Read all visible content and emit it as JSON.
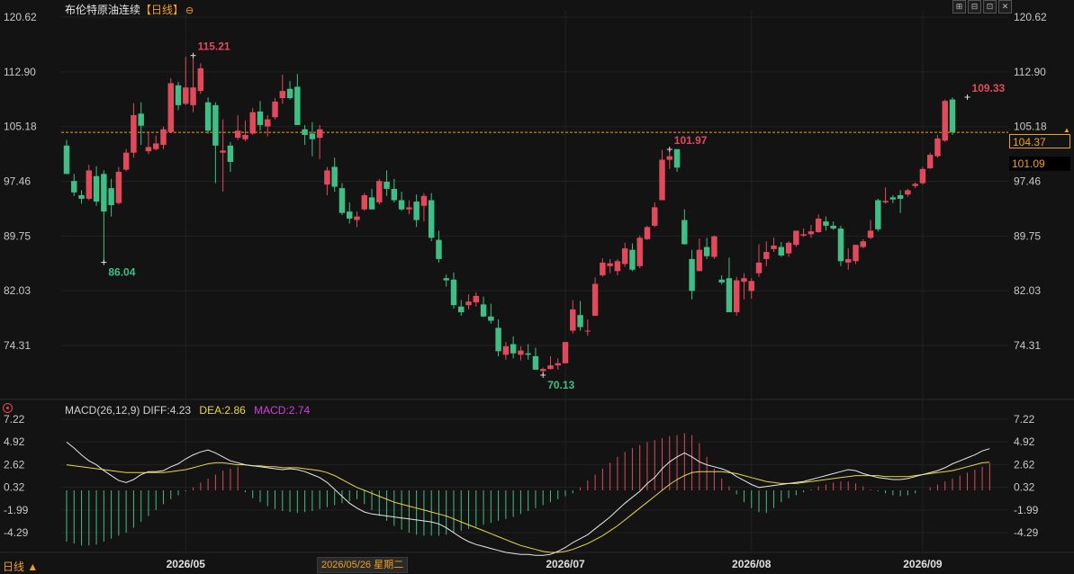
{
  "header": {
    "instrument": "布伦特原油连续",
    "period": "【日线】",
    "icon": "zoom-icon"
  },
  "toolbar": {
    "buttons": [
      "⊞",
      "⊟",
      "⊡",
      "✕"
    ]
  },
  "indicator": {
    "label": "MACD(26,12,9)",
    "diff": "DIFF:4.23",
    "dea": "DEA:2.86",
    "macd": "MACD:2.74"
  },
  "footer": {
    "period_button": "日线 ▲",
    "crosshair_date": "2026/05/26 星期二"
  },
  "price_tags": {
    "current": "104.37",
    "other": "101.09"
  },
  "colors": {
    "up": "#e24a5b",
    "down": "#3fbf86",
    "diff": "#e8e8e8",
    "dea": "#e8d840",
    "accent": "#f0a020"
  },
  "chart_data": [
    {
      "type": "candlestick",
      "title": "布伦特原油连续",
      "y_ticks": [
        "120.62",
        "112.90",
        "105.18",
        "97.46",
        "89.75",
        "82.03",
        "74.31"
      ],
      "ylim": [
        70.13,
        120.62
      ],
      "x_ticks": [
        {
          "label": "2026/05",
          "index": 16
        },
        {
          "label": "2026/07",
          "index": 67
        },
        {
          "label": "2026/08",
          "index": 92
        },
        {
          "label": "2026/09",
          "index": 115
        }
      ],
      "reference_line": 104.37,
      "annotations": [
        {
          "text": "115.21",
          "value": 115.21,
          "index": 17,
          "type": "high"
        },
        {
          "text": "86.04",
          "value": 86.04,
          "index": 5,
          "type": "low"
        },
        {
          "text": "70.13",
          "value": 70.13,
          "index": 64,
          "type": "low"
        },
        {
          "text": "101.97",
          "value": 101.97,
          "index": 81,
          "type": "high"
        },
        {
          "text": "109.33",
          "value": 109.33,
          "index": 121,
          "type": "high"
        }
      ],
      "ohlc": [
        [
          102.5,
          103.3,
          98.5,
          98.5
        ],
        [
          97.5,
          98.5,
          95.4,
          95.9
        ],
        [
          95.5,
          96.2,
          94.3,
          95.0
        ],
        [
          95.0,
          99.8,
          94.8,
          99.0
        ],
        [
          98.2,
          99.6,
          94.0,
          94.6
        ],
        [
          98.5,
          99.0,
          86.0,
          93.2
        ],
        [
          96.5,
          97.8,
          92.5,
          94.1
        ],
        [
          94.4,
          99.5,
          94.2,
          98.8
        ],
        [
          99.1,
          102.0,
          98.9,
          101.5
        ],
        [
          101.5,
          108.5,
          100.8,
          106.8
        ],
        [
          107.0,
          108.6,
          102.6,
          105.3
        ],
        [
          101.7,
          104.5,
          101.3,
          102.3
        ],
        [
          102.0,
          103.9,
          101.8,
          102.8
        ],
        [
          102.6,
          105.2,
          102.0,
          104.8
        ],
        [
          104.4,
          112.0,
          104.4,
          111.3
        ],
        [
          111.0,
          111.5,
          107.5,
          108.2
        ],
        [
          108.4,
          115.0,
          108.2,
          110.7
        ],
        [
          108.2,
          115.2,
          107.2,
          110.7
        ],
        [
          110.2,
          114.1,
          109.8,
          113.4
        ],
        [
          108.6,
          109.3,
          104.2,
          104.6
        ],
        [
          108.2,
          108.6,
          97.2,
          102.5
        ],
        [
          101.5,
          106.2,
          96.0,
          101.8
        ],
        [
          102.5,
          103.0,
          98.8,
          100.2
        ],
        [
          103.6,
          106.8,
          103.3,
          104.6
        ],
        [
          103.4,
          106.0,
          103.1,
          104.0
        ],
        [
          104.2,
          107.8,
          104.0,
          107.2
        ],
        [
          107.3,
          108.8,
          104.6,
          105.4
        ],
        [
          105.2,
          106.8,
          103.8,
          106.2
        ],
        [
          106.5,
          109.2,
          106.2,
          108.7
        ],
        [
          109.2,
          112.5,
          108.4,
          110.2
        ],
        [
          110.5,
          111.6,
          109.0,
          109.2
        ],
        [
          110.8,
          112.6,
          105.6,
          105.4
        ],
        [
          104.8,
          105.4,
          102.6,
          104.0
        ],
        [
          104.2,
          105.8,
          101.0,
          103.4
        ],
        [
          103.6,
          105.4,
          100.6,
          104.8
        ],
        [
          97.0,
          99.5,
          95.5,
          99.0
        ],
        [
          99.5,
          100.8,
          96.0,
          96.7
        ],
        [
          96.5,
          97.2,
          92.7,
          93.0
        ],
        [
          93.2,
          94.5,
          91.5,
          92.2
        ],
        [
          92.0,
          93.2,
          91.0,
          92.5
        ],
        [
          93.5,
          95.8,
          93.3,
          95.5
        ],
        [
          95.2,
          96.4,
          93.5,
          93.5
        ],
        [
          94.5,
          97.8,
          94.2,
          97.5
        ],
        [
          97.4,
          99.0,
          95.4,
          96.4
        ],
        [
          96.4,
          97.8,
          94.5,
          94.8
        ],
        [
          94.8,
          96.0,
          93.3,
          93.5
        ],
        [
          93.5,
          94.8,
          92.8,
          93.8
        ],
        [
          94.6,
          95.6,
          91.0,
          92.0
        ],
        [
          94.0,
          95.8,
          91.8,
          95.4
        ],
        [
          94.8,
          95.8,
          89.0,
          89.5
        ],
        [
          89.2,
          90.5,
          86.0,
          86.5
        ],
        [
          83.8,
          84.3,
          82.6,
          83.5
        ],
        [
          83.6,
          84.6,
          79.5,
          80.0
        ],
        [
          79.8,
          80.7,
          78.5,
          79.0
        ],
        [
          80.0,
          81.5,
          79.4,
          80.5
        ],
        [
          80.4,
          81.8,
          79.8,
          81.3
        ],
        [
          80.1,
          81.2,
          78.3,
          78.4
        ],
        [
          78.4,
          80.2,
          77.4,
          77.8
        ],
        [
          76.8,
          78.0,
          72.8,
          73.5
        ],
        [
          73.0,
          74.8,
          72.3,
          74.2
        ],
        [
          74.5,
          75.6,
          72.5,
          73.2
        ],
        [
          73.0,
          74.2,
          72.2,
          73.6
        ],
        [
          73.2,
          74.5,
          72.3,
          73.0
        ],
        [
          72.8,
          74.0,
          70.9,
          70.9
        ],
        [
          70.7,
          71.2,
          70.1,
          71.0
        ],
        [
          71.0,
          72.8,
          70.9,
          71.5
        ],
        [
          71.5,
          72.5,
          70.9,
          71.8
        ],
        [
          71.8,
          74.5,
          71.8,
          74.8
        ],
        [
          76.4,
          80.7,
          76.0,
          79.4
        ],
        [
          78.6,
          80.6,
          76.4,
          76.9
        ],
        [
          76.4,
          78.0,
          75.7,
          76.4
        ],
        [
          78.5,
          83.9,
          78.5,
          83.0
        ],
        [
          84.2,
          86.6,
          84.0,
          86.0
        ],
        [
          85.5,
          86.5,
          84.5,
          85.9
        ],
        [
          84.8,
          86.5,
          84.2,
          86.2
        ],
        [
          85.8,
          88.8,
          85.4,
          88.0
        ],
        [
          87.8,
          88.7,
          84.8,
          85.0
        ],
        [
          85.5,
          89.8,
          85.2,
          89.5
        ],
        [
          89.3,
          91.2,
          89.2,
          91.0
        ],
        [
          91.2,
          94.5,
          91.0,
          93.8
        ],
        [
          94.8,
          101.9,
          94.8,
          100.5
        ],
        [
          100.5,
          102.0,
          99.2,
          101.0
        ],
        [
          102.0,
          100.8,
          98.8,
          99.4
        ],
        [
          92.0,
          93.5,
          88.5,
          88.6
        ],
        [
          86.5,
          87.8,
          80.8,
          82.0
        ],
        [
          84.8,
          89.4,
          84.8,
          87.8
        ],
        [
          88.2,
          89.5,
          86.5,
          86.9
        ],
        [
          86.8,
          89.8,
          86.5,
          89.7
        ],
        [
          83.6,
          84.2,
          82.9,
          83.2
        ],
        [
          83.8,
          86.7,
          79.2,
          79.0
        ],
        [
          79.0,
          84.0,
          78.5,
          83.5
        ],
        [
          83.3,
          84.5,
          80.8,
          83.8
        ],
        [
          82.0,
          83.8,
          80.9,
          83.4
        ],
        [
          84.5,
          88.6,
          84.0,
          86.0
        ],
        [
          86.5,
          89.0,
          85.5,
          87.5
        ],
        [
          87.9,
          89.5,
          87.5,
          88.4
        ],
        [
          88.2,
          88.9,
          86.8,
          87.0
        ],
        [
          87.3,
          89.0,
          86.8,
          88.8
        ],
        [
          88.5,
          90.5,
          88.2,
          90.5
        ],
        [
          89.8,
          90.8,
          89.6,
          90.0
        ],
        [
          90.0,
          91.3,
          89.5,
          90.4
        ],
        [
          90.3,
          92.8,
          90.2,
          92.2
        ],
        [
          91.8,
          92.5,
          90.5,
          91.2
        ],
        [
          91.2,
          91.8,
          90.6,
          90.8
        ],
        [
          90.8,
          91.2,
          85.5,
          86.2
        ],
        [
          86.0,
          88.0,
          85.0,
          86.5
        ],
        [
          86.2,
          88.5,
          85.8,
          88.5
        ],
        [
          88.2,
          89.3,
          88.0,
          89.0
        ],
        [
          89.5,
          92.0,
          89.3,
          90.5
        ],
        [
          94.8,
          95.0,
          90.4,
          90.7
        ],
        [
          94.5,
          96.6,
          94.3,
          94.7
        ],
        [
          95.2,
          95.5,
          94.4,
          94.9
        ],
        [
          95.5,
          96.2,
          93.0,
          95.0
        ],
        [
          95.6,
          96.4,
          95.3,
          96.2
        ],
        [
          96.8,
          97.3,
          96.5,
          97.1
        ],
        [
          97.2,
          99.5,
          97.0,
          99.2
        ],
        [
          99.3,
          101.5,
          99.2,
          101.2
        ],
        [
          101.0,
          104.0,
          100.8,
          103.5
        ],
        [
          103.2,
          109.0,
          103.0,
          108.8
        ],
        [
          109.0,
          109.3,
          104.0,
          104.4
        ]
      ]
    },
    {
      "type": "macd",
      "title": "MACD(26,12,9)",
      "y_ticks": [
        "7.22",
        "4.92",
        "2.62",
        "0.32",
        "-1.99",
        "-4.29"
      ],
      "ylim": [
        -6.59,
        7.22
      ],
      "series": [
        {
          "name": "DIFF",
          "values": [
            4.9,
            4.3,
            3.6,
            3.0,
            2.6,
            2.0,
            1.5,
            1.0,
            0.8,
            1.1,
            1.6,
            1.9,
            1.9,
            2.0,
            2.4,
            2.7,
            3.2,
            3.6,
            3.9,
            4.1,
            3.8,
            3.4,
            3.0,
            2.8,
            2.6,
            2.5,
            2.4,
            2.3,
            2.2,
            2.1,
            2.2,
            2.1,
            1.9,
            1.6,
            1.3,
            0.8,
            0.1,
            -0.6,
            -1.3,
            -1.8,
            -2.2,
            -2.4,
            -2.5,
            -2.6,
            -2.7,
            -2.8,
            -2.9,
            -3.0,
            -3.1,
            -3.2,
            -3.4,
            -3.8,
            -4.3,
            -4.8,
            -5.2,
            -5.5,
            -5.7,
            -5.9,
            -6.1,
            -6.3,
            -6.4,
            -6.5,
            -6.5,
            -6.6,
            -6.6,
            -6.5,
            -6.2,
            -5.8,
            -5.3,
            -4.9,
            -4.5,
            -3.9,
            -3.3,
            -2.7,
            -2.0,
            -1.3,
            -0.7,
            -0.1,
            0.7,
            1.3,
            2.2,
            2.9,
            3.4,
            3.8,
            3.4,
            2.9,
            2.6,
            2.4,
            2.2,
            1.9,
            1.4,
            1.0,
            0.6,
            0.3,
            0.4,
            0.5,
            0.6,
            0.7,
            0.8,
            0.9,
            1.1,
            1.3,
            1.5,
            1.7,
            1.9,
            2.1,
            2.0,
            1.7,
            1.5,
            1.3,
            1.2,
            1.1,
            1.1,
            1.2,
            1.4,
            1.6,
            1.8,
            2.0,
            2.3,
            2.7,
            3.0,
            3.3,
            3.6,
            4.0,
            4.23
          ]
        },
        {
          "name": "DEA",
          "values": [
            2.6,
            2.5,
            2.4,
            2.3,
            2.2,
            2.1,
            2.0,
            1.9,
            1.8,
            1.8,
            1.8,
            1.8,
            1.8,
            1.8,
            1.9,
            2.0,
            2.1,
            2.3,
            2.5,
            2.7,
            2.8,
            2.8,
            2.7,
            2.6,
            2.6,
            2.5,
            2.5,
            2.4,
            2.4,
            2.3,
            2.3,
            2.3,
            2.2,
            2.1,
            2.0,
            1.8,
            1.5,
            1.1,
            0.7,
            0.3,
            0.0,
            -0.3,
            -0.6,
            -0.9,
            -1.2,
            -1.4,
            -1.6,
            -1.8,
            -2.0,
            -2.2,
            -2.4,
            -2.6,
            -2.9,
            -3.2,
            -3.5,
            -3.8,
            -4.1,
            -4.4,
            -4.7,
            -5.0,
            -5.3,
            -5.6,
            -5.8,
            -6.0,
            -6.2,
            -6.3,
            -6.3,
            -6.2,
            -6.0,
            -5.7,
            -5.4,
            -5.0,
            -4.6,
            -4.1,
            -3.6,
            -3.0,
            -2.4,
            -1.8,
            -1.2,
            -0.6,
            0.0,
            0.6,
            1.1,
            1.5,
            1.8,
            1.9,
            1.9,
            1.9,
            1.9,
            1.8,
            1.7,
            1.5,
            1.3,
            1.1,
            0.9,
            0.8,
            0.7,
            0.7,
            0.7,
            0.8,
            0.9,
            1.0,
            1.1,
            1.2,
            1.3,
            1.4,
            1.5,
            1.5,
            1.5,
            1.5,
            1.4,
            1.4,
            1.4,
            1.4,
            1.5,
            1.6,
            1.7,
            1.8,
            1.9,
            2.0,
            2.2,
            2.4,
            2.6,
            2.8,
            2.86
          ]
        },
        {
          "name": "MACD",
          "values": [
            -5.2,
            -5.4,
            -5.6,
            -5.6,
            -5.5,
            -5.2,
            -4.9,
            -4.6,
            -4.3,
            -3.8,
            -3.2,
            -2.6,
            -2.0,
            -1.4,
            -0.9,
            -0.5,
            -0.1,
            0.3,
            0.8,
            1.2,
            1.6,
            2.0,
            2.2,
            2.4,
            -0.2,
            -0.8,
            -1.2,
            -1.6,
            -1.9,
            -2.1,
            -2.2,
            -2.3,
            -2.2,
            -2.1,
            -1.9,
            -1.7,
            -1.5,
            -1.3,
            -1.1,
            -0.9,
            -1.4,
            -2.0,
            -2.6,
            -3.1,
            -3.6,
            -4.0,
            -4.3,
            -4.5,
            -4.6,
            -4.6,
            -4.6,
            -4.5,
            -4.3,
            -4.1,
            -3.9,
            -3.7,
            -3.5,
            -3.3,
            -3.1,
            -2.9,
            -2.7,
            -2.4,
            -2.1,
            -1.8,
            -1.5,
            -1.2,
            -0.9,
            -0.6,
            -0.3,
            0.3,
            1.0,
            1.6,
            2.2,
            2.8,
            3.4,
            3.9,
            4.3,
            4.6,
            4.9,
            5.1,
            5.3,
            5.5,
            5.6,
            5.8,
            5.6,
            4.8,
            3.4,
            2.2,
            1.2,
            0.4,
            -0.4,
            -1.2,
            -1.8,
            -2.2,
            -2.3,
            -1.8,
            -1.2,
            -0.8,
            -0.5,
            -0.2,
            0.1,
            0.4,
            0.6,
            0.8,
            0.9,
            0.9,
            0.7,
            0.4,
            0.1,
            -0.1,
            -0.3,
            -0.5,
            -0.6,
            -0.5,
            -0.3,
            0.0,
            0.3,
            0.6,
            0.9,
            1.2,
            1.5,
            1.8,
            2.1,
            2.4,
            2.74
          ]
        }
      ]
    }
  ]
}
